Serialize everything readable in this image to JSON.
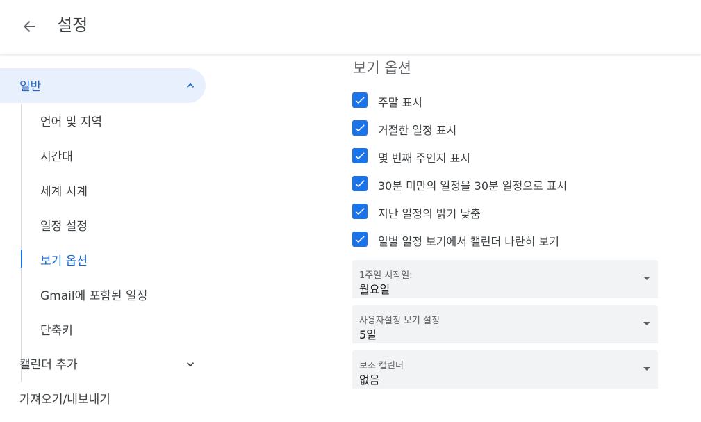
{
  "header": {
    "title": "설정"
  },
  "sidebar": {
    "active_group": "일반",
    "general_items": [
      "언어 및 지역",
      "시간대",
      "세계 시계",
      "일정 설정",
      "보기 옵션",
      "Gmail에 포함된 일정",
      "단축키"
    ],
    "active_item": "보기 옵션",
    "groups": [
      "캘린더 추가",
      "가져오기/내보내기"
    ]
  },
  "main": {
    "section_title": "보기 옵션",
    "checkboxes": [
      {
        "label": "주말 표시",
        "checked": true
      },
      {
        "label": "거절한 일정 표시",
        "checked": true
      },
      {
        "label": "몇 번째 주인지 표시",
        "checked": true
      },
      {
        "label": "30분 미만의 일정을 30분 일정으로 표시",
        "checked": true
      },
      {
        "label": "지난 일정의 밝기 낮춤",
        "checked": true
      },
      {
        "label": "일별 일정 보기에서 캘린더 나란히 보기",
        "checked": true
      }
    ],
    "selects": [
      {
        "label": "1주일 시작일:",
        "value": "월요일"
      },
      {
        "label": "사용자설정 보기 설정",
        "value": "5일"
      },
      {
        "label": "보조 캘린더",
        "value": "없음"
      }
    ]
  },
  "colors": {
    "accent": "#1a73e8",
    "active_bg": "#e8f0fe",
    "active_text": "#1967d2"
  },
  "icons": {
    "back": "arrow-back-icon",
    "expand_less": "chevron-up-icon",
    "expand_more": "chevron-down-icon",
    "check": "check-icon"
  }
}
